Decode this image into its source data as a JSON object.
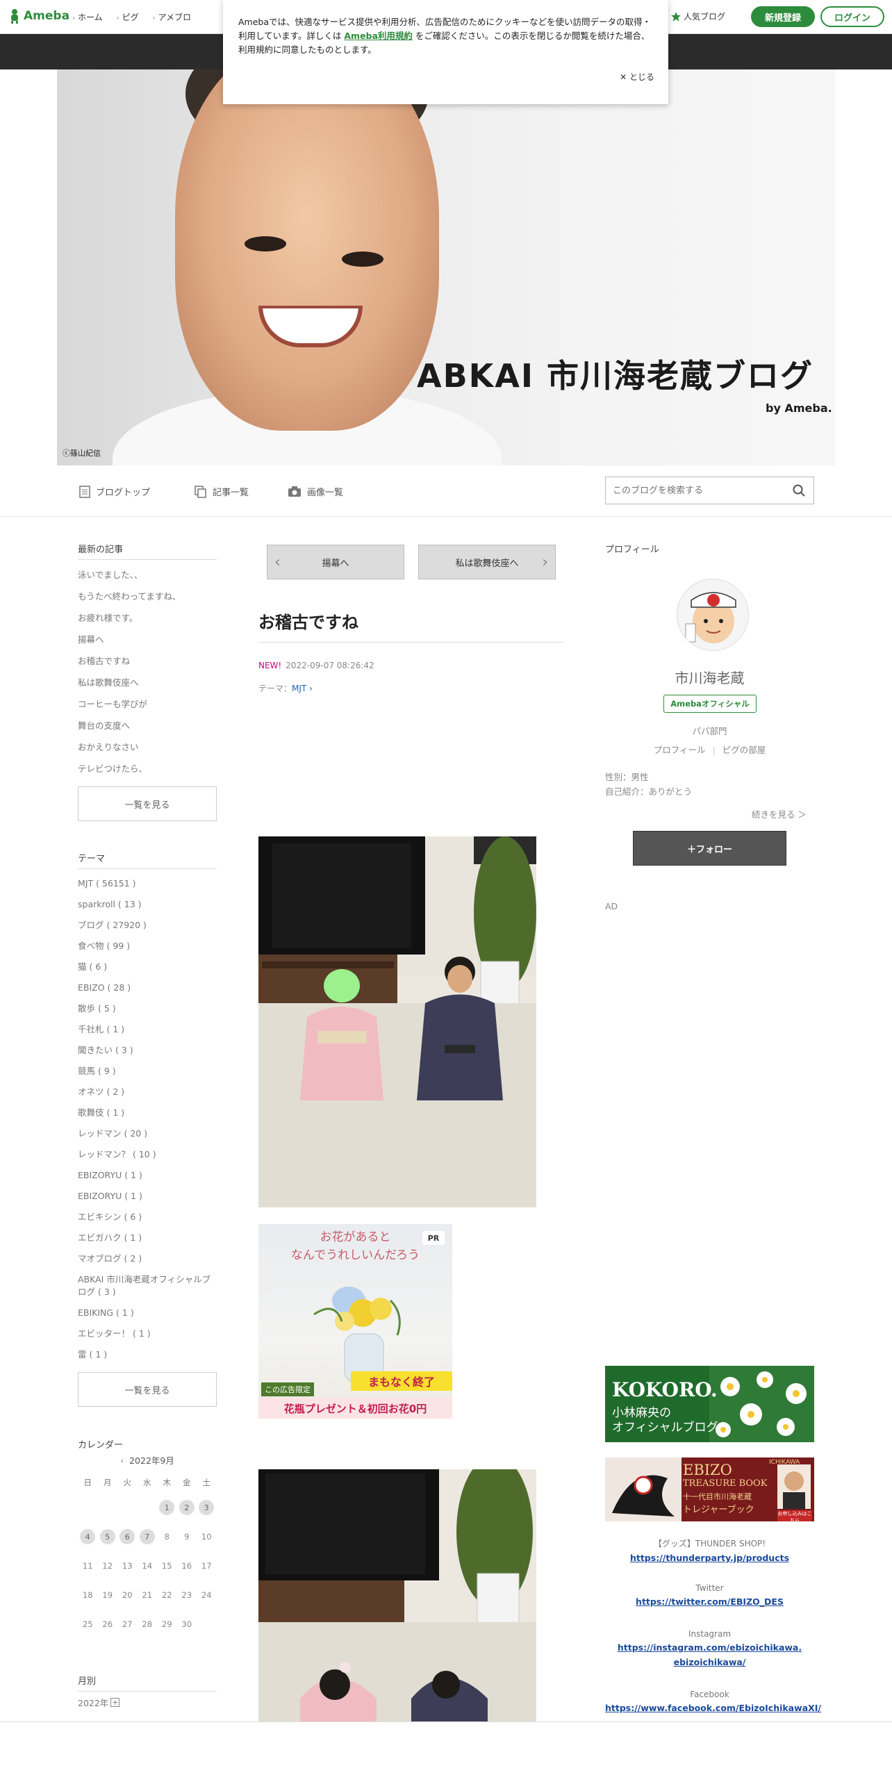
{
  "header": {
    "logo": "Ameba",
    "nav": [
      "ホーム",
      "ピグ",
      "アメブロ"
    ],
    "popular": "人気ブログ",
    "signup": "新規登録",
    "login": "ログイン"
  },
  "cookie": {
    "text_before": "Amebaでは、快適なサービス提供や利用分析、広告配信のためにクッキーなどを使い訪問データの取得・利用しています。詳しくは",
    "link": "Ameba利用規約",
    "text_after": "をご確認ください。この表示を閉じるか閲覧を続けた場合、利用規約に同意したものとします。",
    "close": "✕ とじる"
  },
  "hero": {
    "title": "ABKAI 市川海老蔵ブログ",
    "by": "by Ameba.",
    "credit": "ⓒ篠山紀信"
  },
  "blognav": {
    "top": "ブログトップ",
    "list": "記事一覧",
    "images": "画像一覧",
    "search_placeholder": "このブログを検索する"
  },
  "left": {
    "recent_title": "最新の記事",
    "recent": [
      "泳いでました、、",
      "もうたべ終わってますね、",
      "お疲れ様です。",
      "揚幕へ",
      "お稽古ですね",
      "私は歌舞伎座へ",
      "コーヒーも学びが",
      "舞台の支度へ",
      "おかえりなさい",
      "テレビつけたら、"
    ],
    "see_all": "一覧を見る",
    "theme_title": "テーマ",
    "themes": [
      "MJT ( 56151 )",
      "sparkroll ( 13 )",
      "ブログ ( 27920 )",
      "食べ物 ( 99 )",
      "猫 ( 6 )",
      "EBIZO ( 28 )",
      "散歩 ( 5 )",
      "千社札 ( 1 )",
      "聞きたい ( 3 )",
      "競馬 ( 9 )",
      "オネツ ( 2 )",
      "歌舞伎 ( 1 )",
      "レッドマン ( 20 )",
      "レッドマン？ ( 10 )",
      "EBIZORYU ( 1 )",
      "EBIZORYU ( 1 )",
      "エビキシン ( 6 )",
      "エビガハク ( 1 )",
      "マオブログ ( 2 )",
      "ABKAI 市川海老蔵オフィシャルブログ ( 3 )",
      "EBIKING ( 1 )",
      "エビッター！ ( 1 )",
      "雷 ( 1 )"
    ],
    "theme_see_all": "一覧を見る",
    "calendar_title": "カレンダー",
    "calendar_month": "2022年9月",
    "weekdays": [
      "日",
      "月",
      "火",
      "水",
      "木",
      "金",
      "土"
    ],
    "cal_rows": [
      [
        "",
        "",
        "",
        "",
        "1",
        "2",
        "3"
      ],
      [
        "4",
        "5",
        "6",
        "7",
        "8",
        "9",
        "10"
      ],
      [
        "11",
        "12",
        "13",
        "14",
        "15",
        "16",
        "17"
      ],
      [
        "18",
        "19",
        "20",
        "21",
        "22",
        "23",
        "24"
      ],
      [
        "25",
        "26",
        "27",
        "28",
        "29",
        "30",
        ""
      ]
    ],
    "cal_marked": [
      "1",
      "2",
      "3",
      "4",
      "5",
      "6",
      "7"
    ],
    "monthly_title": "月別",
    "monthly_year": "2022年"
  },
  "main": {
    "prev": "揚幕へ",
    "next": "私は歌舞伎座へ",
    "title": "お稽古ですね",
    "new_label": "NEW!",
    "datetime": "2022-09-07 08:26:42",
    "theme_label": "テーマ：",
    "theme": "MJT",
    "ad": {
      "pr": "PR",
      "line1": "お花があると",
      "line2": "なんでうれしいんだろう",
      "limited": "この広告限定",
      "ending": "まもなく終了",
      "offer": "花瓶プレゼント＆初回お花0円"
    }
  },
  "right": {
    "profile_title": "プロフィール",
    "name": "市川海老蔵",
    "badge": "Amebaオフィシャル",
    "category": "パパ部門",
    "profile_link": "プロフィール",
    "room_link": "ピグの部屋",
    "gender": "性別：男性",
    "intro": "自己紹介：ありがとう",
    "read_more": "続きを見る ＞",
    "follow": "＋フォロー",
    "ad": "AD",
    "banner_kokoro": {
      "title": "KOKORO.",
      "line1": "小林麻央の",
      "line2": "オフィシャルブログ"
    },
    "banner_ebizo": {
      "line1": "EBIZO",
      "line2": "TREASURE BOOK",
      "line3": "十一代目市川海老蔵",
      "line4": "トレジャーブック",
      "side": "ICHIKAWA",
      "tag": "お申し込みはこちら"
    },
    "links": [
      {
        "label": "【グッズ】THUNDER SHOP!",
        "url": "https://thunderparty.jp/products"
      },
      {
        "label": "Twitter",
        "url": "https://twitter.com/EBIZO_DES"
      },
      {
        "label": "Instagram",
        "url": "https://instagram.com/ebizoichikawa.ebizoichikawa/"
      },
      {
        "label": "Facebook",
        "url": "https://www.facebook.com/EbizoIchikawaXI/"
      }
    ]
  },
  "colors": {
    "brand_green": "#2d8c3c",
    "dark_bar": "#2b2b2b",
    "new_pink": "#d0007a",
    "link_blue": "#1a4a9c"
  }
}
